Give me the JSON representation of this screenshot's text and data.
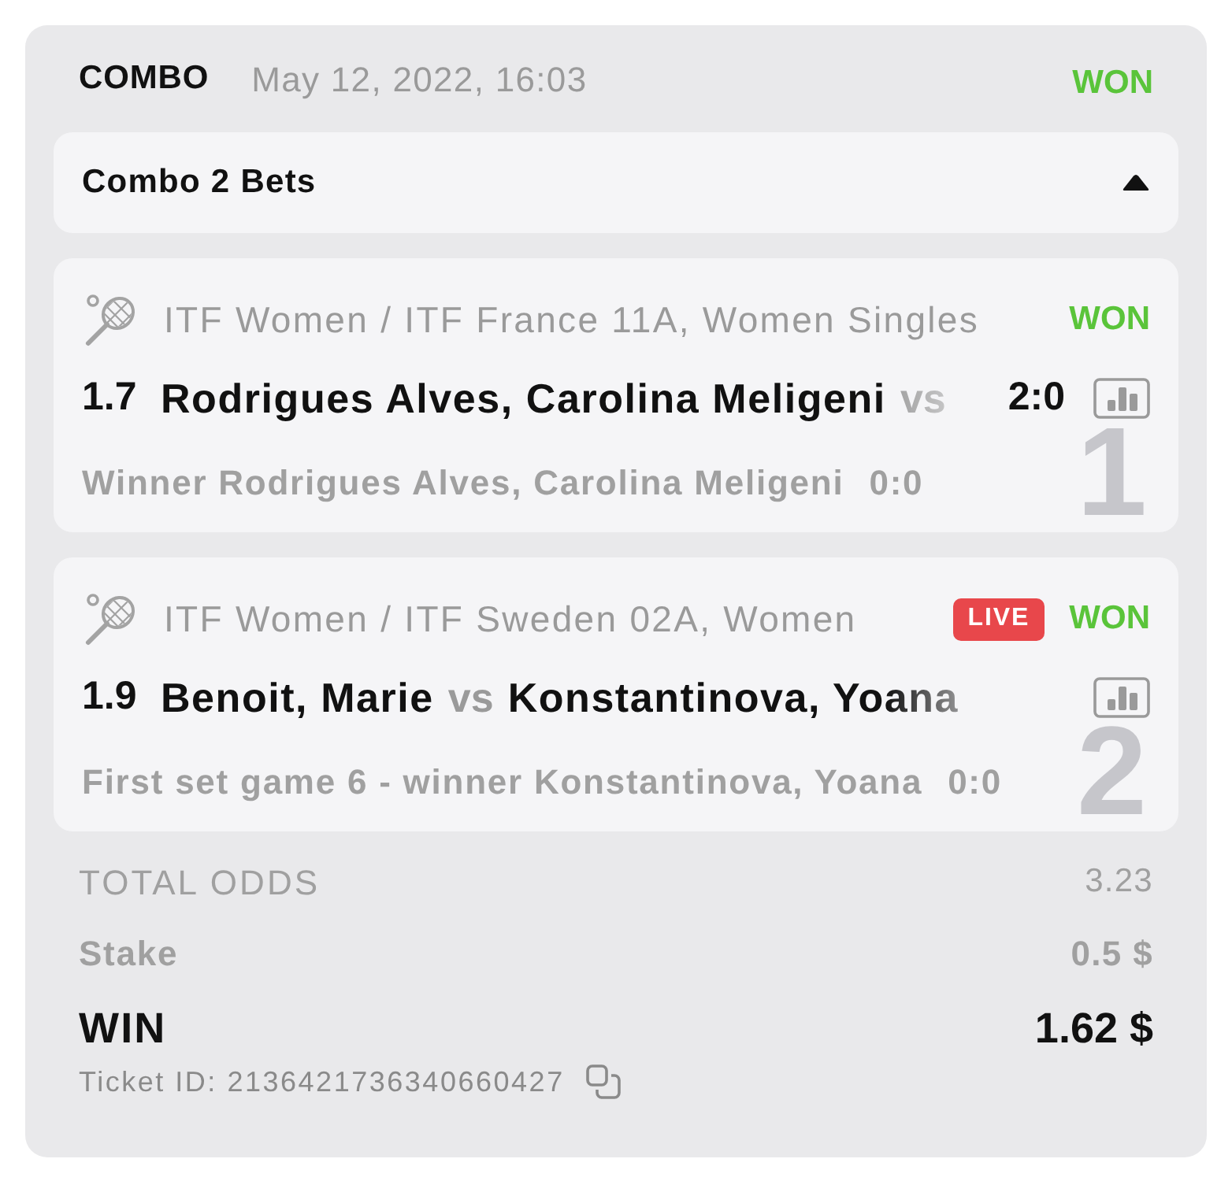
{
  "header": {
    "title": "COMBO",
    "date": "May 12, 2022, 16:03",
    "status": {
      "label": "WON",
      "kind": "won"
    }
  },
  "bets_panel": {
    "title": "Combo 2 Bets",
    "expanded": true
  },
  "bets": [
    {
      "number": "1",
      "league": "ITF Women / ITF France 11A, Women Singles",
      "status": {
        "label": "WON",
        "kind": "won"
      },
      "odds": "1.7",
      "participants": [
        "Rodrigues Alves, Carolina Meligeni"
      ],
      "separator": "vs",
      "score": "2:0",
      "selection": "Winner Rodrigues Alves, Carolina Meligeni",
      "selection_score": "0:0"
    },
    {
      "number": "2",
      "league": "ITF Women / ITF Sweden 02A, Women",
      "badge": {
        "label": "LIVE",
        "kind": "live"
      },
      "status": {
        "label": "WON",
        "kind": "won"
      },
      "odds": "1.9",
      "participants": [
        "Benoit, Marie",
        "Konstantinova, Yoana"
      ],
      "separator": "vs",
      "selection": "First set game 6 - winner Konstantinova, Yoana",
      "selection_score": "0:0"
    }
  ],
  "summary": [
    {
      "kind": "odds",
      "label": "TOTAL ODDS",
      "value": "3.23"
    },
    {
      "kind": "stake",
      "label": "Stake",
      "value": "0.5 $"
    },
    {
      "kind": "win",
      "label": "WIN",
      "value": "1.62 $"
    }
  ],
  "ticket_id": "Ticket ID: 2136421736340660427"
}
